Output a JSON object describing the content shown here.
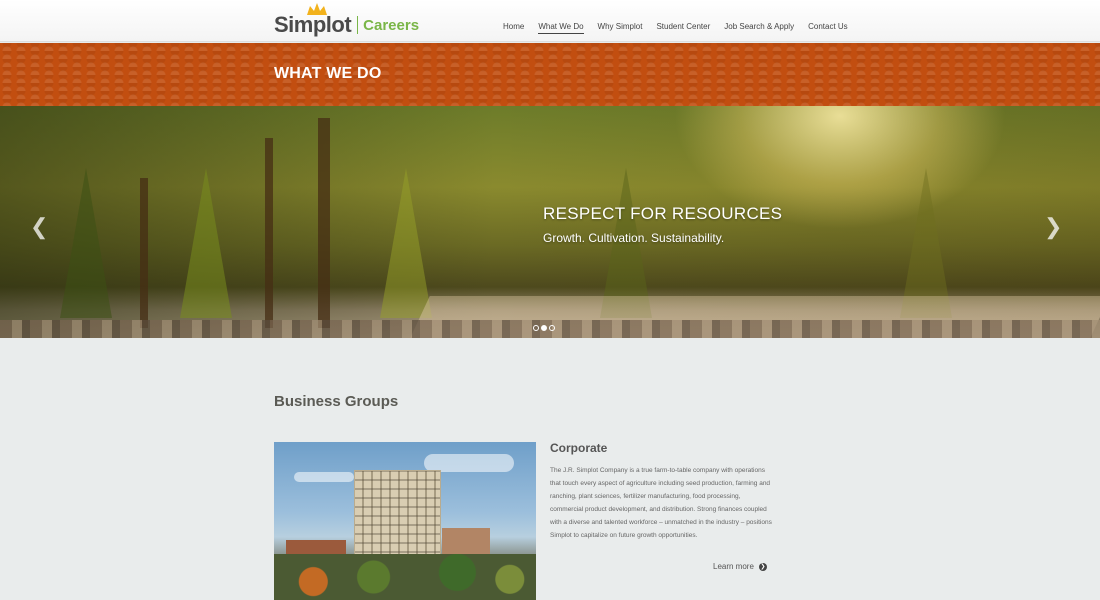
{
  "brand": {
    "name": "Simplot",
    "tagline": "Careers",
    "accent": "#7ab648",
    "title_band_color": "#c24e10"
  },
  "nav": {
    "items": [
      {
        "label": "Home",
        "active": false
      },
      {
        "label": "What We Do",
        "active": true
      },
      {
        "label": "Why Simplot",
        "active": false
      },
      {
        "label": "Student Center",
        "active": false
      },
      {
        "label": "Job Search & Apply",
        "active": false
      },
      {
        "label": "Contact Us",
        "active": false
      }
    ]
  },
  "page": {
    "title": "WHAT WE DO"
  },
  "hero": {
    "heading": "RESPECT FOR RESOURCES",
    "subheading": "Growth. Cultivation. Sustainability.",
    "prev_icon": "chevron-left-icon",
    "next_icon": "chevron-right-icon",
    "slides": 3,
    "active_slide": 2
  },
  "business_groups": {
    "title": "Business Groups",
    "cards": [
      {
        "title": "Corporate",
        "text": "The J.R. Simplot Company is a true farm-to-table company with operations that touch every aspect of agriculture including seed production, farming and ranching, plant sciences, fertilizer manufacturing, food processing, commercial product development, and distribution. Strong finances coupled with a diverse and talented workforce – unmatched in the industry – positions Simplot to capitalize on future growth opportunities.",
        "link_label": "Learn more",
        "link_icon": "circle-arrow-right-icon"
      }
    ]
  }
}
